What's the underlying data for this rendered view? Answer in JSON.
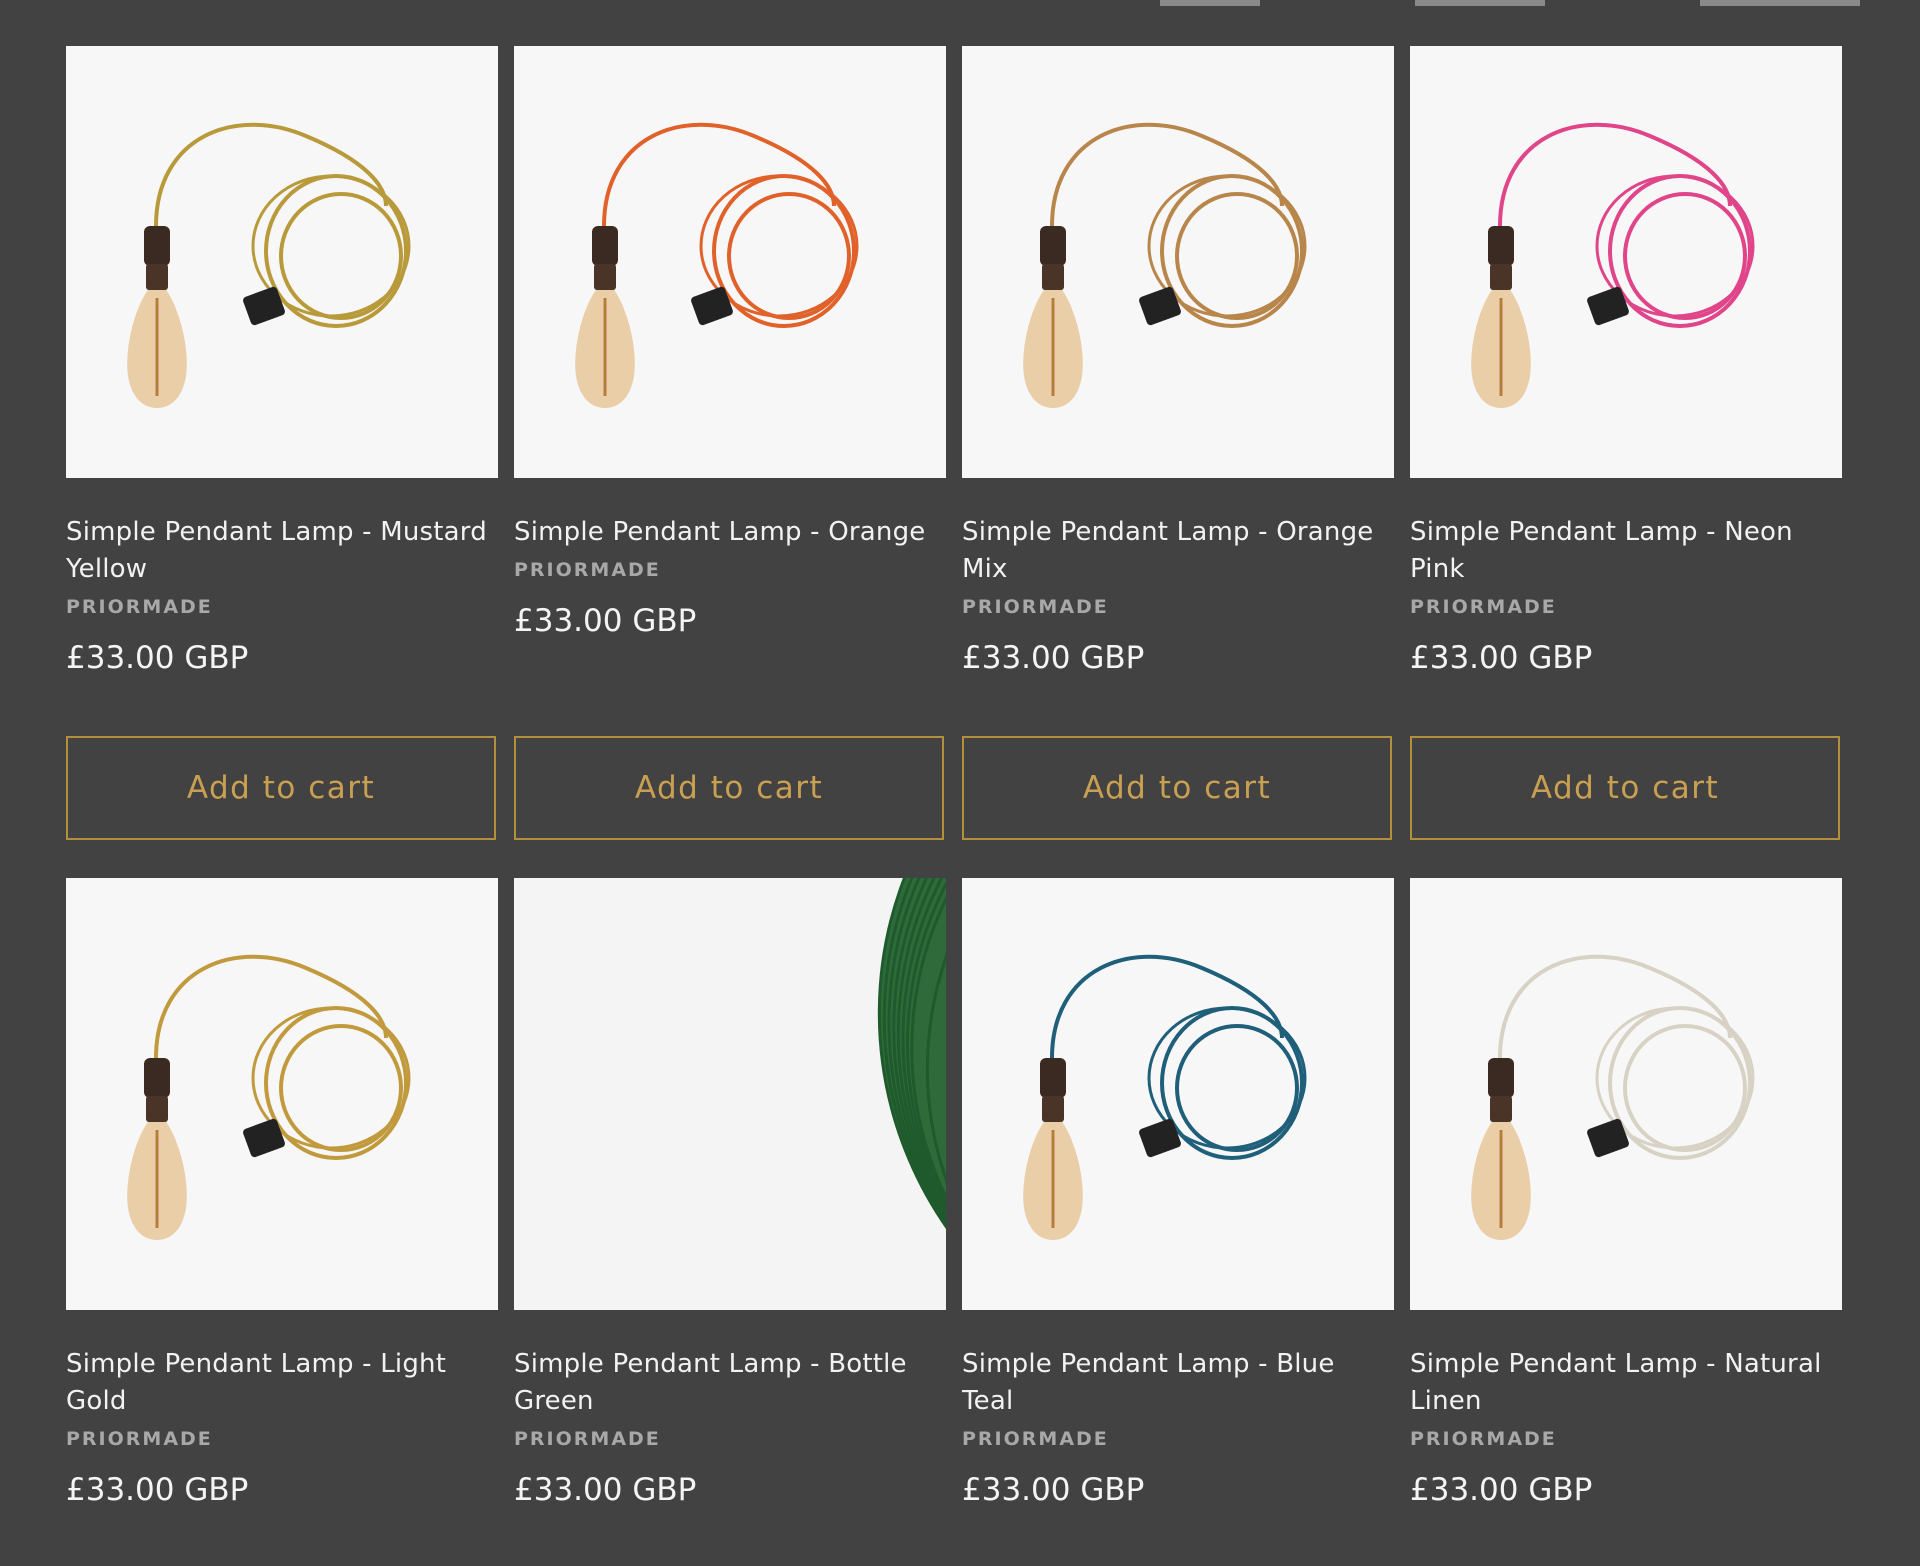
{
  "colors": {
    "background": "#424242",
    "accent": "#c9a052",
    "button_border": "#b38f3a"
  },
  "products": [
    {
      "title": "Simple Pendant Lamp - Mustard Yellow",
      "vendor": "PRIORMADE",
      "price": "£33.00 GBP",
      "cable_color": "#b89a3a",
      "image": "pendant-lamp"
    },
    {
      "title": "Simple Pendant Lamp - Orange",
      "vendor": "PRIORMADE",
      "price": "£33.00 GBP",
      "cable_color": "#e0622a",
      "image": "pendant-lamp"
    },
    {
      "title": "Simple Pendant Lamp - Orange Mix",
      "vendor": "PRIORMADE",
      "price": "£33.00 GBP",
      "cable_color": "#b8864a",
      "image": "pendant-lamp"
    },
    {
      "title": "Simple Pendant Lamp - Neon Pink",
      "vendor": "PRIORMADE",
      "price": "£33.00 GBP",
      "cable_color": "#e0458a",
      "image": "pendant-lamp"
    },
    {
      "title": "Simple Pendant Lamp - Light Gold",
      "vendor": "PRIORMADE",
      "price": "£33.00 GBP",
      "cable_color": "#c29a3e",
      "image": "pendant-lamp"
    },
    {
      "title": "Simple Pendant Lamp - Bottle Green",
      "vendor": "PRIORMADE",
      "price": "£33.00 GBP",
      "cable_color": "#2f6b3a",
      "image": "cable-coil"
    },
    {
      "title": "Simple Pendant Lamp - Blue Teal",
      "vendor": "PRIORMADE",
      "price": "£33.00 GBP",
      "cable_color": "#1f5f7a",
      "image": "pendant-lamp"
    },
    {
      "title": "Simple Pendant Lamp - Natural Linen",
      "vendor": "PRIORMADE",
      "price": "£33.00 GBP",
      "cable_color": "#d8d2c4",
      "image": "pendant-lamp"
    }
  ],
  "cart_button_label": "Add to cart"
}
